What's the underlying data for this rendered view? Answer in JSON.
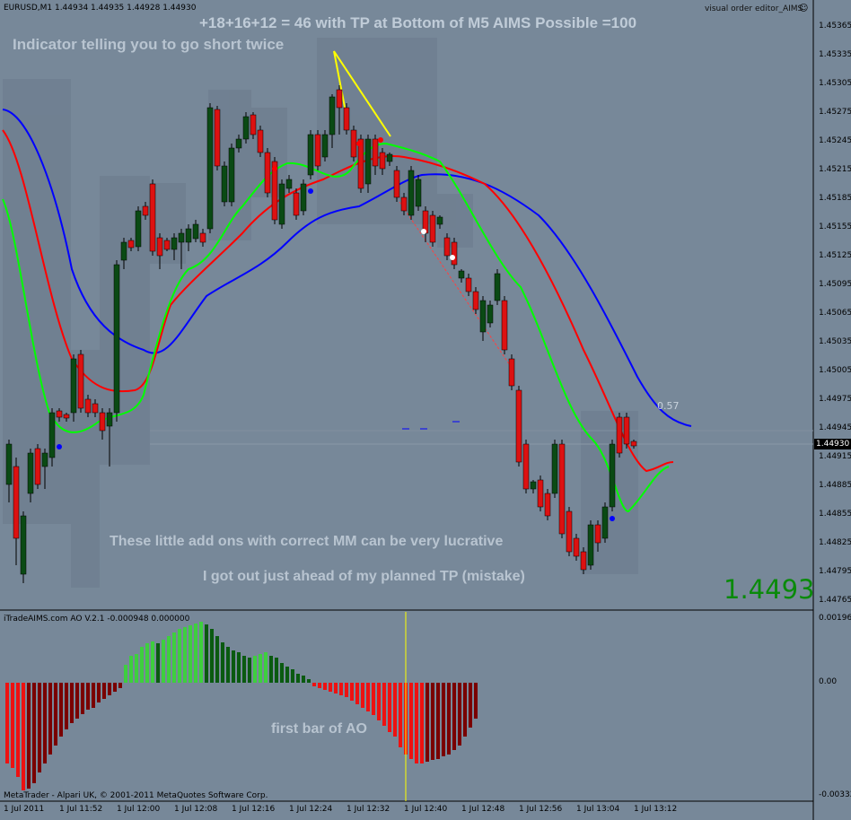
{
  "header": {
    "symbol_line": "EURUSD,M1  1.44934 1.44935 1.44928 1.44930",
    "title_note": "+18+16+12 = 46  with TP at Bottom of M5 AIMS Possible =100",
    "editor_label": "visual order editor_AIMS",
    "smiley": "☺"
  },
  "annotations": {
    "short_note": "Indicator telling you to go short twice",
    "addons_note": "These little add ons with correct MM can be very lucrative",
    "exit_note": "I got out just ahead of my planned TP (mistake)",
    "ao_note": "first bar of AO",
    "level_label": "0.57",
    "big_price": "1.4493"
  },
  "price_axis": {
    "ticks": [
      "1.45365",
      "1.45335",
      "1.45305",
      "1.45275",
      "1.45245",
      "1.45215",
      "1.45185",
      "1.45155",
      "1.45125",
      "1.45095",
      "1.45065",
      "1.45035",
      "1.45005",
      "1.44975",
      "1.44945",
      "1.44915",
      "1.44885",
      "1.44855",
      "1.44825",
      "1.44795",
      "1.44765"
    ],
    "current": "1.44930"
  },
  "ao_panel": {
    "title": "iTradeAIMS.com AO V.2.1 -0.000948 0.000000",
    "ticks": [
      "0.001965",
      "0.00",
      "-0.003327"
    ]
  },
  "footer": {
    "copyright": "MetaTrader - Alpari UK, © 2001-2011 MetaQuotes Software Corp."
  },
  "time_axis": {
    "ticks": [
      "1 Jul 2011",
      "1 Jul 11:52",
      "1 Jul 12:00",
      "1 Jul 12:08",
      "1 Jul 12:16",
      "1 Jul 12:24",
      "1 Jul 12:32",
      "1 Jul 12:40",
      "1 Jul 12:48",
      "1 Jul 12:56",
      "1 Jul 13:04",
      "1 Jul 13:12"
    ]
  },
  "colors": {
    "background": "#778899",
    "bull": "#0a4a14",
    "bear": "#dd1111",
    "ma_blue": "#0000ff",
    "ma_red": "#ff0000",
    "ma_green": "#00ff00",
    "trendline": "#ffff00",
    "ao_up": "#32cd32",
    "ao_down": "#ff0000"
  }
}
